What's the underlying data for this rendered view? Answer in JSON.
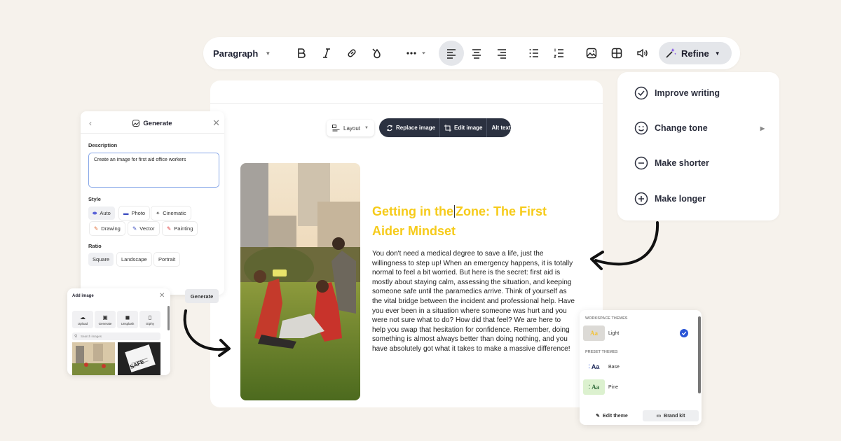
{
  "toolbar": {
    "paragraph_label": "Paragraph",
    "refine_label": "Refine"
  },
  "image_toolbar": {
    "layout_label": "Layout",
    "replace_label": "Replace image",
    "edit_label": "Edit image",
    "alt_label": "Alt text"
  },
  "article": {
    "heading_part1": "Getting in the",
    "heading_part2": "Zone: The First Aider Mindset",
    "body": "You don't need a medical degree to save a life, just the willingness to step up! When an emergency happens, it is totally normal to feel a bit worried. But here is the secret: first aid is mostly about staying calm, assessing the situation, and keeping someone safe until the paramedics arrive. Think of yourself as the vital bridge between the incident and professional help. Have you ever been in a situation where someone was hurt and you were not sure what to do? How did that feel? We are here to help you swap that hesitation for confidence. Remember, doing something is almost always better than doing nothing, and you have absolutely got what it takes to make a massive difference!",
    "heading_color": "#f6cb1a"
  },
  "refine_menu": {
    "items": [
      {
        "label": "Improve writing",
        "icon": "check-circle-icon"
      },
      {
        "label": "Change tone",
        "icon": "smiley-icon"
      },
      {
        "label": "Make shorter",
        "icon": "minus-circle-icon"
      },
      {
        "label": "Make longer",
        "icon": "plus-circle-icon"
      }
    ]
  },
  "generate_panel": {
    "title": "Generate",
    "description_label": "Description",
    "description_value": "Create an image for first aid office workers",
    "style_label": "Style",
    "styles": [
      "Auto",
      "Photo",
      "Cinematic",
      "Drawing",
      "Vector",
      "Painting"
    ],
    "selected_style": "Auto",
    "ratio_label": "Ratio",
    "ratios": [
      "Square",
      "Landscape",
      "Portrait"
    ],
    "selected_ratio": "Square",
    "generate_button": "Generate"
  },
  "add_image_panel": {
    "title": "Add image",
    "sources": [
      "Upload",
      "Generate",
      "Unsplash",
      "Giphy"
    ],
    "search_placeholder": "Search images",
    "thumb_text": "SAFE"
  },
  "theme_panel": {
    "workspace_label": "WORKSPACE THEMES",
    "preset_label": "PRESET THEMES",
    "themes": [
      {
        "name": "Light",
        "swatch": "Aa",
        "selected": true
      },
      {
        "name": "Base",
        "swatch": "Aa"
      },
      {
        "name": "Pine",
        "swatch": "Aa"
      }
    ],
    "edit_theme": "Edit theme",
    "brand_kit": "Brand kit"
  }
}
